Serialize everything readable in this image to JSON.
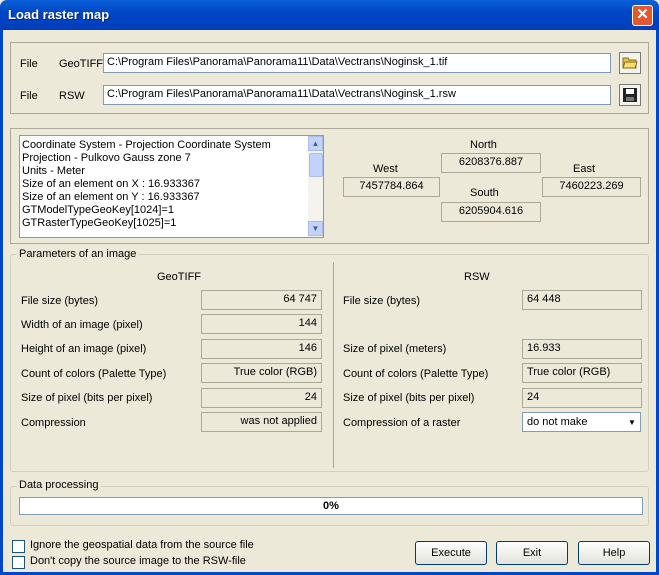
{
  "window": {
    "title": "Load raster map",
    "close_label": "✕"
  },
  "files": {
    "geotiff": {
      "file_label": "File",
      "type_label": "GeoTIFF",
      "path": "C:\\Program Files\\Panorama\\Panorama11\\Data\\Vectrans\\Noginsk_1.tif",
      "button_icon": "folder-open-icon"
    },
    "rsw": {
      "file_label": "File",
      "type_label": "RSW",
      "path": "C:\\Program Files\\Panorama\\Panorama11\\Data\\Vectrans\\Noginsk_1.rsw",
      "button_icon": "save-disk-icon"
    }
  },
  "info_list": [
    "Coordinate System - Projection Coordinate System",
    "Projection - Pulkovo Gauss zone 7",
    "Units - Meter",
    "Size of an element on X : 16.933367",
    "Size of an element on Y : 16.933367",
    "GTModelTypeGeoKey[1024]=1",
    "GTRasterTypeGeoKey[1025]=1"
  ],
  "bounds": {
    "north_label": "North",
    "north": "6208376.887",
    "west_label": "West",
    "west": "7457784.864",
    "east_label": "East",
    "east": "7460223.269",
    "south_label": "South",
    "south": "6205904.616"
  },
  "params": {
    "group_label": "Parameters of an image",
    "geotiff": {
      "header": "GeoTIFF",
      "rows": [
        {
          "label": "File size (bytes)",
          "value": "64 747"
        },
        {
          "label": "Width of an image (pixel)",
          "value": "144"
        },
        {
          "label": "Height of an image (pixel)",
          "value": "146"
        },
        {
          "label": "Count of colors (Palette Type)",
          "value": "True color (RGB)"
        },
        {
          "label": "Size of pixel (bits per pixel)",
          "value": "24"
        },
        {
          "label": "Compression",
          "value": "was not applied"
        }
      ]
    },
    "rsw": {
      "header": "RSW",
      "file_size_label": "File size (bytes)",
      "file_size": "64 448",
      "pixel_size_label": "Size of pixel (meters)",
      "pixel_size": "16.933",
      "colors_label": "Count of colors (Palette Type)",
      "colors": "True color (RGB)",
      "bits_label": "Size of pixel (bits per pixel)",
      "bits": "24",
      "compression_label": "Compression of a raster",
      "compression": "do not make"
    }
  },
  "processing": {
    "group_label": "Data processing",
    "progress_text": "0%",
    "progress_value": 0
  },
  "options": {
    "ignore_geo": {
      "label": "Ignore the geospatial data from the source file",
      "checked": false
    },
    "dont_copy": {
      "label": "Don't copy the source image to the RSW-file",
      "checked": false
    }
  },
  "buttons": {
    "execute": "Execute",
    "exit": "Exit",
    "help": "Help"
  }
}
